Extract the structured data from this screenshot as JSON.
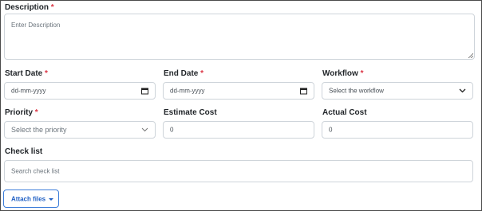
{
  "form": {
    "description": {
      "label": "Description",
      "required_mark": "*",
      "placeholder": "Enter Description"
    },
    "start_date": {
      "label": "Start Date",
      "required_mark": "*",
      "value": "dd-mm-yyyy",
      "icon": "calendar-icon"
    },
    "end_date": {
      "label": "End Date",
      "required_mark": "*",
      "value": "dd-mm-yyyy",
      "icon": "calendar-icon"
    },
    "workflow": {
      "label": "Workflow",
      "required_mark": "*",
      "selected": "Select the workflow",
      "icon": "chevron-down-icon"
    },
    "priority": {
      "label": "Priority",
      "required_mark": "*",
      "selected": "Select the priority",
      "icon": "chevron-down-icon"
    },
    "estimate_cost": {
      "label": "Estimate Cost",
      "value": "0"
    },
    "actual_cost": {
      "label": "Actual Cost",
      "value": "0"
    },
    "check_list": {
      "label": "Check list",
      "placeholder": "Search check list"
    },
    "attach_files": {
      "label": "Attach files",
      "icon": "caret-down-icon"
    }
  },
  "colors": {
    "required": "#dc3545",
    "accent": "#1f5fc4",
    "border": "#ced4da"
  }
}
